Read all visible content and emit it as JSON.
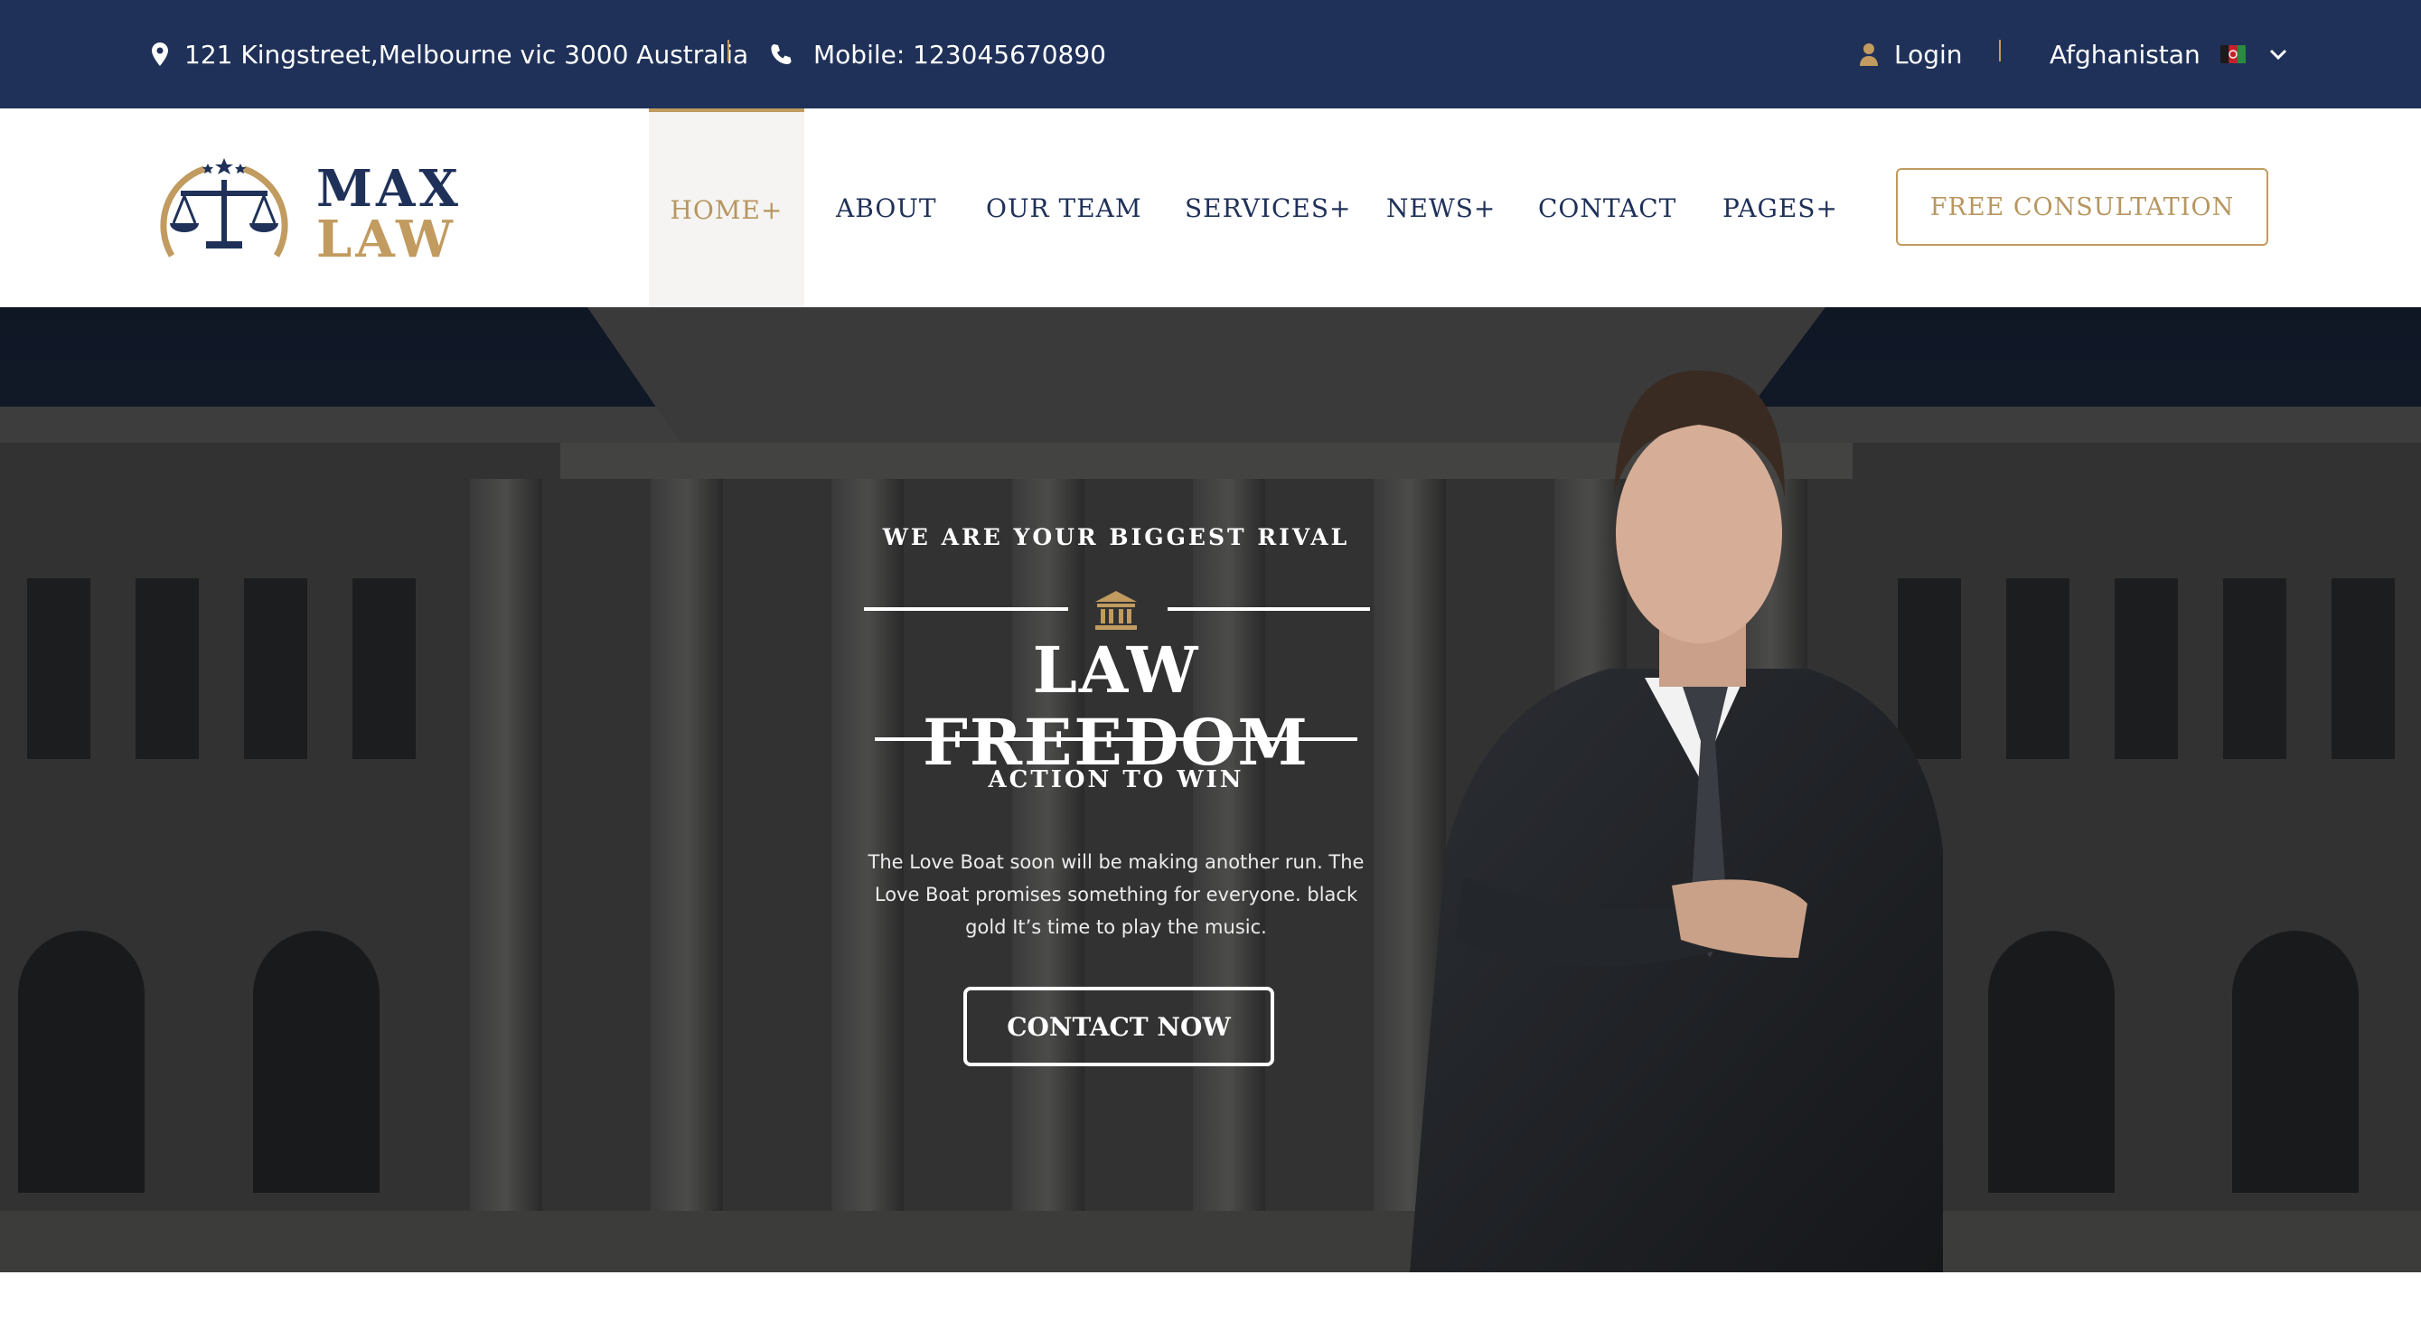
{
  "topbar": {
    "address": "121 Kingstreet,Melbourne vic 3000 Australia",
    "phone": "Mobile: 123045670890",
    "login": "Login",
    "country": "Afghanistan",
    "icons": [
      "map-marker-icon",
      "phone-icon",
      "user-icon",
      "flag-icon",
      "chevron-down-icon"
    ]
  },
  "logo": {
    "line1": "MAX",
    "line2": "LAW"
  },
  "nav": {
    "items": [
      {
        "label": "HOME+"
      },
      {
        "label": "ABOUT"
      },
      {
        "label": "OUR TEAM"
      },
      {
        "label": "SERVICES+"
      },
      {
        "label": "NEWS+"
      },
      {
        "label": "CONTACT"
      },
      {
        "label": "PAGES+"
      }
    ],
    "cta": "FREE CONSULTATION"
  },
  "hero": {
    "eyebrow": "WE ARE YOUR BIGGEST RIVAL",
    "title": "LAW FREEDOM",
    "subtitle": "ACTION TO WIN",
    "description": "The Love Boat soon will be making another run. The Love Boat promises something for everyone. black gold It’s time to play the music.",
    "button": "CONTACT NOW"
  },
  "colors": {
    "navy": "#1f3159",
    "gold": "#c19b5f",
    "white": "#ffffff"
  }
}
